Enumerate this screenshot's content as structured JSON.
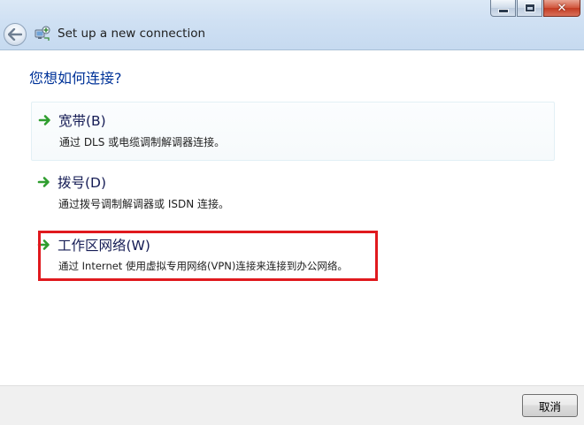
{
  "window": {
    "title": "Set up a new connection",
    "caption_buttons": {
      "minimize_icon": "minimize-icon",
      "maximize_icon": "maximize-icon",
      "close_icon": "close-icon",
      "close_glyph": "✕"
    },
    "back_icon": "back-arrow-icon",
    "app_icon": "network-connection-icon"
  },
  "main": {
    "question": "您想如何连接?",
    "options": [
      {
        "title": "宽带(B)",
        "description": "通过 DLS 或电缆调制解调器连接。",
        "icon": "green-arrow-icon"
      },
      {
        "title": "拨号(D)",
        "description": "通过拨号调制解调器或 ISDN 连接。",
        "icon": "green-arrow-icon"
      },
      {
        "title": "工作区网络(W)",
        "description": "通过 Internet 使用虚拟专用网络(VPN)连接来连接到办公网络。",
        "icon": "green-arrow-icon",
        "annotated": true
      }
    ]
  },
  "footer": {
    "cancel_label": "取消"
  },
  "colors": {
    "heading_blue": "#003399",
    "option_title": "#151c55",
    "annotation_red": "#e0191e",
    "arrow_green": "#2f9e2f"
  }
}
